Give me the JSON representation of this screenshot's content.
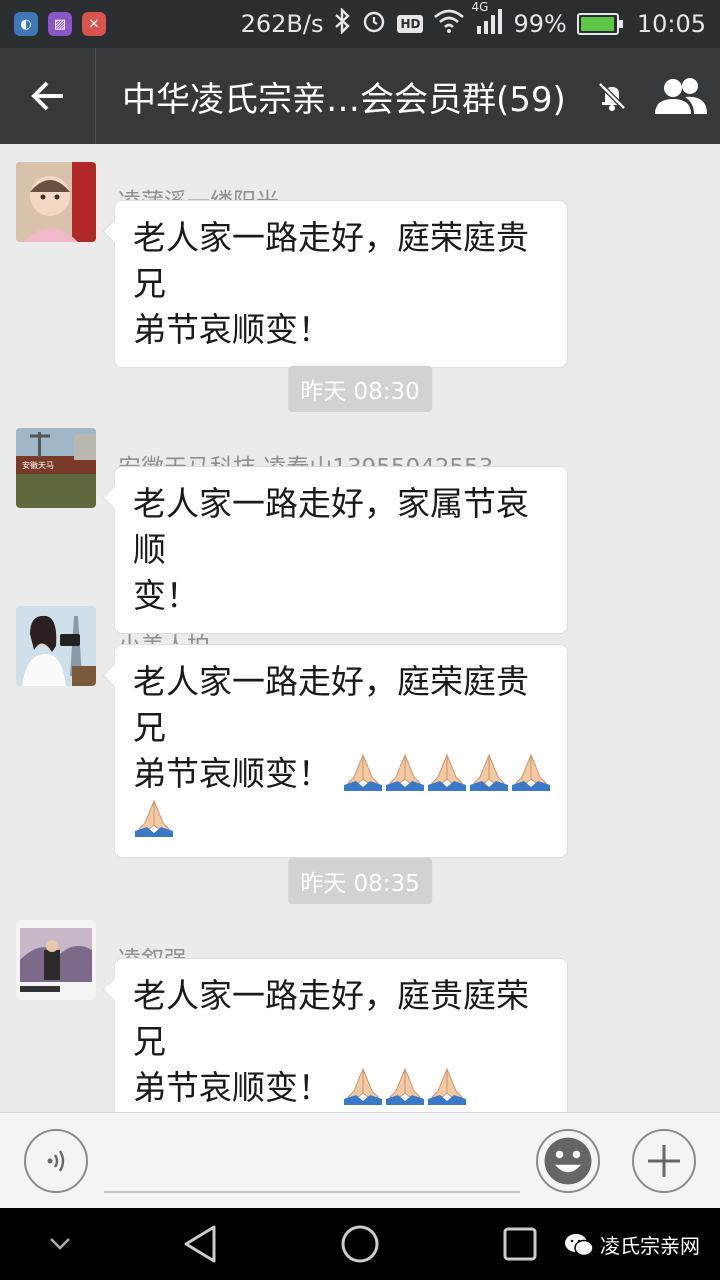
{
  "status_bar": {
    "net_speed": "262B/s",
    "hd_badge": "HD",
    "network_type": "4G",
    "battery_percent": "99%",
    "battery_level": 0.99,
    "time": "10:05",
    "app_icons": [
      "ingress-icon",
      "gallery-icon",
      "tools-icon"
    ],
    "icons": [
      "bluetooth-icon",
      "alarm-icon",
      "wifi-icon",
      "signal-icon",
      "battery-icon"
    ]
  },
  "header": {
    "title": "中华凌氏宗亲…会会员群(59)",
    "back_icon": "back-arrow-icon",
    "mute_icon": "bell-off-icon",
    "members_icon": "group-members-icon"
  },
  "messages": [
    {
      "sender": "凌蒲溪一缕阳光",
      "line1": "老人家一路走好，庭荣庭贵兄",
      "line2": "弟节哀顺变！",
      "emoji_count": 0
    },
    {
      "sender": "安徽天马科技 凌春山13955042553",
      "line1": "老人家一路走好，家属节哀顺",
      "line2": "变！",
      "emoji_count": 0
    },
    {
      "sender": "小美人拍",
      "line1": "老人家一路走好，庭荣庭贵兄",
      "line2": "弟节哀顺变！",
      "emoji_count": 6,
      "emoji_name": "folded-hands-emoji"
    },
    {
      "sender": "凌叙强",
      "line1": "老人家一路走好，庭贵庭荣兄",
      "line2": "弟节哀顺变！",
      "emoji_count": 3,
      "emoji_name": "folded-hands-emoji"
    }
  ],
  "timestamps": [
    "昨天 08:30",
    "昨天 08:35"
  ],
  "input_bar": {
    "voice_icon": "voice-input-icon",
    "emoji_icon": "smiley-icon",
    "more_icon": "plus-icon"
  },
  "nav_bar": {
    "icons": [
      "collapse-icon",
      "back-triangle-icon",
      "home-circle-icon",
      "recents-square-icon"
    ],
    "watermark": "凌氏宗亲网"
  }
}
